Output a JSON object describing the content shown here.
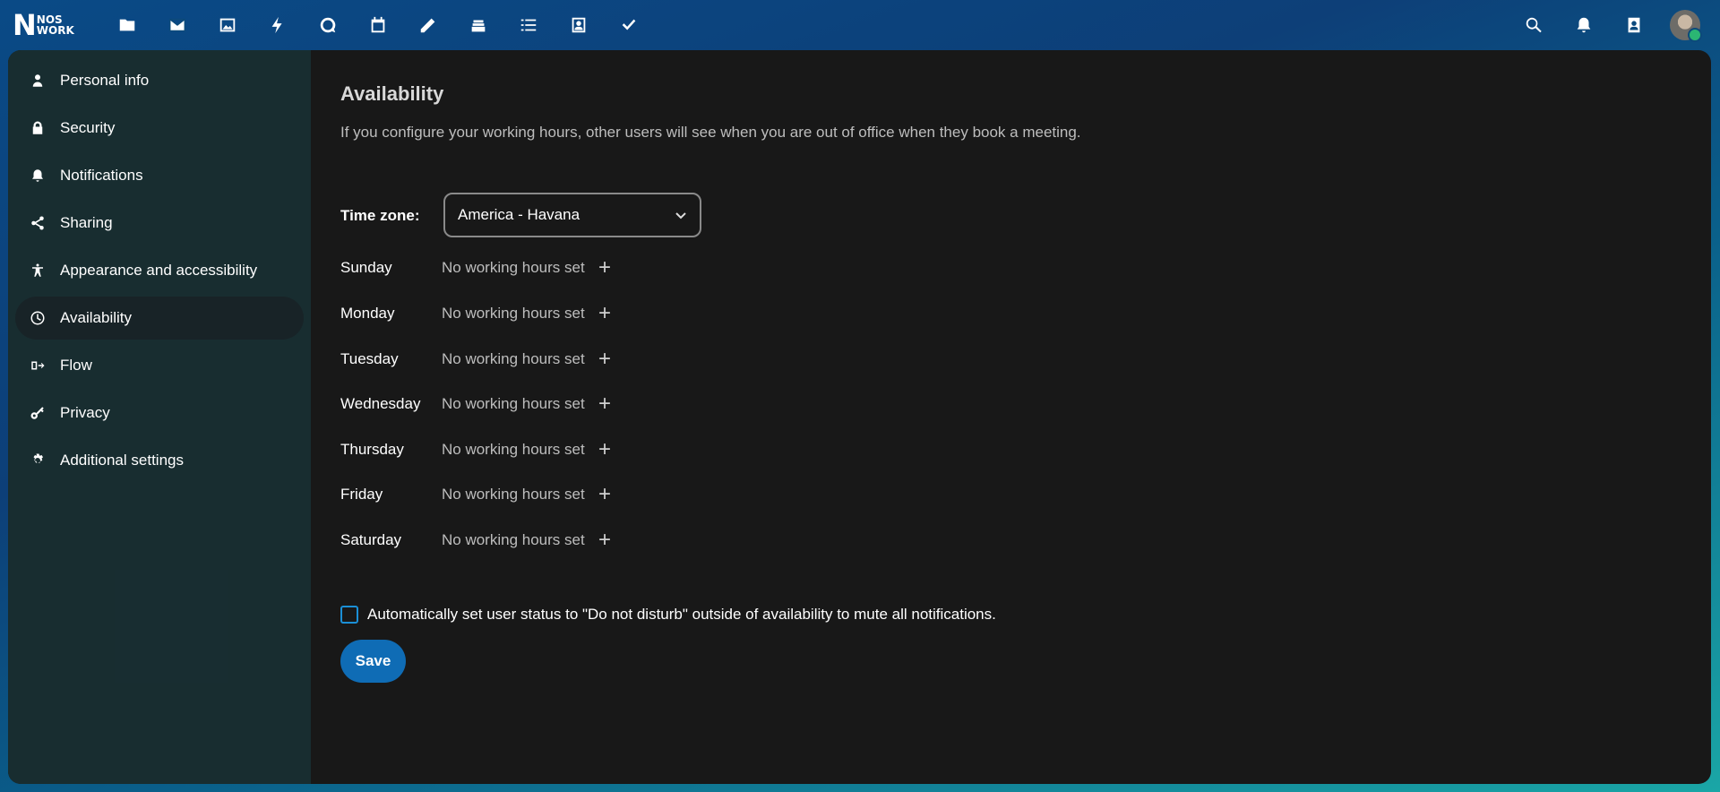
{
  "brand": {
    "logo_letter": "N",
    "logo_line1": "NOS",
    "logo_line2": "WORK"
  },
  "top_apps": [
    "files-icon",
    "mail-icon",
    "photos-icon",
    "activity-icon",
    "talk-icon",
    "calendar-icon",
    "notes-icon",
    "deck-icon",
    "tasks-icon",
    "contacts-app-icon",
    "checkmark-icon"
  ],
  "header_right": [
    "search-icon",
    "notifications-icon",
    "contacts-icon"
  ],
  "sidebar": {
    "items": [
      {
        "label": "Personal info",
        "icon": "person-icon"
      },
      {
        "label": "Security",
        "icon": "lock-icon"
      },
      {
        "label": "Notifications",
        "icon": "bell-icon"
      },
      {
        "label": "Sharing",
        "icon": "share-icon"
      },
      {
        "label": "Appearance and accessibility",
        "icon": "accessibility-icon"
      },
      {
        "label": "Availability",
        "icon": "clock-icon",
        "active": true
      },
      {
        "label": "Flow",
        "icon": "flow-icon"
      },
      {
        "label": "Privacy",
        "icon": "key-icon"
      },
      {
        "label": "Additional settings",
        "icon": "gear-icon"
      }
    ]
  },
  "main": {
    "title": "Availability",
    "description": "If you configure your working hours, other users will see when you are out of office when they book a meeting.",
    "timezone_label": "Time zone:",
    "timezone_value": "America - Havana",
    "days": [
      {
        "day": "Sunday",
        "value": "No working hours set"
      },
      {
        "day": "Monday",
        "value": "No working hours set"
      },
      {
        "day": "Tuesday",
        "value": "No working hours set"
      },
      {
        "day": "Wednesday",
        "value": "No working hours set"
      },
      {
        "day": "Thursday",
        "value": "No working hours set"
      },
      {
        "day": "Friday",
        "value": "No working hours set"
      },
      {
        "day": "Saturday",
        "value": "No working hours set"
      }
    ],
    "plus_label": "+",
    "dnd_label": "Automatically set user status to \"Do not disturb\" outside of availability to mute all notifications.",
    "dnd_checked": false,
    "save_label": "Save"
  },
  "colors": {
    "accent": "#0f6cb5",
    "background": "#181818",
    "sidebar": "#182e32"
  }
}
